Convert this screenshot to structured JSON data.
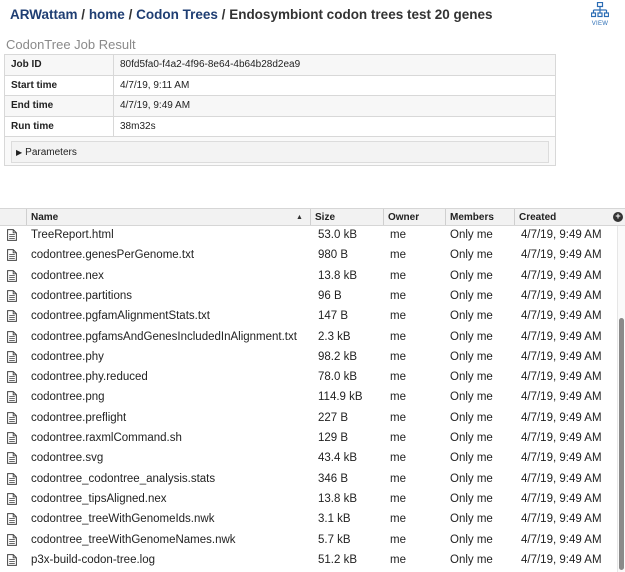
{
  "breadcrumb": {
    "items": [
      "ARWattam",
      "home",
      "Codon Trees"
    ],
    "separator": "/",
    "current": "Endosymbiont codon trees test 20 genes"
  },
  "view_button": {
    "label": "VIEW",
    "icon": "hierarchy-tree-icon"
  },
  "job": {
    "title": "CodonTree Job Result",
    "rows": [
      {
        "label": "Job ID",
        "value": "80fd5fa0-f4a2-4f96-8e64-4b64b28d2ea9"
      },
      {
        "label": "Start time",
        "value": "4/7/19, 9:11 AM"
      },
      {
        "label": "End time",
        "value": "4/7/19, 9:49 AM"
      },
      {
        "label": "Run time",
        "value": "38m32s"
      }
    ],
    "parameters_label": "Parameters"
  },
  "file_table": {
    "columns": {
      "name": "Name",
      "size": "Size",
      "owner": "Owner",
      "members": "Members",
      "created": "Created"
    },
    "sort": "ascending",
    "files": [
      {
        "name": "TreeReport.html",
        "size": "53.0 kB",
        "owner": "me",
        "members": "Only me",
        "created": "4/7/19, 9:49 AM"
      },
      {
        "name": "codontree.genesPerGenome.txt",
        "size": "980 B",
        "owner": "me",
        "members": "Only me",
        "created": "4/7/19, 9:49 AM"
      },
      {
        "name": "codontree.nex",
        "size": "13.8 kB",
        "owner": "me",
        "members": "Only me",
        "created": "4/7/19, 9:49 AM"
      },
      {
        "name": "codontree.partitions",
        "size": "96 B",
        "owner": "me",
        "members": "Only me",
        "created": "4/7/19, 9:49 AM"
      },
      {
        "name": "codontree.pgfamAlignmentStats.txt",
        "size": "147 B",
        "owner": "me",
        "members": "Only me",
        "created": "4/7/19, 9:49 AM"
      },
      {
        "name": "codontree.pgfamsAndGenesIncludedInAlignment.txt",
        "size": "2.3 kB",
        "owner": "me",
        "members": "Only me",
        "created": "4/7/19, 9:49 AM"
      },
      {
        "name": "codontree.phy",
        "size": "98.2 kB",
        "owner": "me",
        "members": "Only me",
        "created": "4/7/19, 9:49 AM"
      },
      {
        "name": "codontree.phy.reduced",
        "size": "78.0 kB",
        "owner": "me",
        "members": "Only me",
        "created": "4/7/19, 9:49 AM"
      },
      {
        "name": "codontree.png",
        "size": "114.9 kB",
        "owner": "me",
        "members": "Only me",
        "created": "4/7/19, 9:49 AM"
      },
      {
        "name": "codontree.preflight",
        "size": "227 B",
        "owner": "me",
        "members": "Only me",
        "created": "4/7/19, 9:49 AM"
      },
      {
        "name": "codontree.raxmlCommand.sh",
        "size": "129 B",
        "owner": "me",
        "members": "Only me",
        "created": "4/7/19, 9:49 AM"
      },
      {
        "name": "codontree.svg",
        "size": "43.4 kB",
        "owner": "me",
        "members": "Only me",
        "created": "4/7/19, 9:49 AM"
      },
      {
        "name": "codontree_codontree_analysis.stats",
        "size": "346 B",
        "owner": "me",
        "members": "Only me",
        "created": "4/7/19, 9:49 AM"
      },
      {
        "name": "codontree_tipsAligned.nex",
        "size": "13.8 kB",
        "owner": "me",
        "members": "Only me",
        "created": "4/7/19, 9:49 AM"
      },
      {
        "name": "codontree_treeWithGenomeIds.nwk",
        "size": "3.1 kB",
        "owner": "me",
        "members": "Only me",
        "created": "4/7/19, 9:49 AM"
      },
      {
        "name": "codontree_treeWithGenomeNames.nwk",
        "size": "5.7 kB",
        "owner": "me",
        "members": "Only me",
        "created": "4/7/19, 9:49 AM"
      },
      {
        "name": "p3x-build-codon-tree.log",
        "size": "51.2 kB",
        "owner": "me",
        "members": "Only me",
        "created": "4/7/19, 9:49 AM"
      }
    ]
  },
  "icons": {
    "file": "document-file-icon",
    "sort": "sort-up-icon",
    "add_column": "add-column-icon"
  },
  "colors": {
    "link": "#1f3e73",
    "header_bg": "#f2f2f2",
    "view_blue": "#2a6cb4"
  }
}
